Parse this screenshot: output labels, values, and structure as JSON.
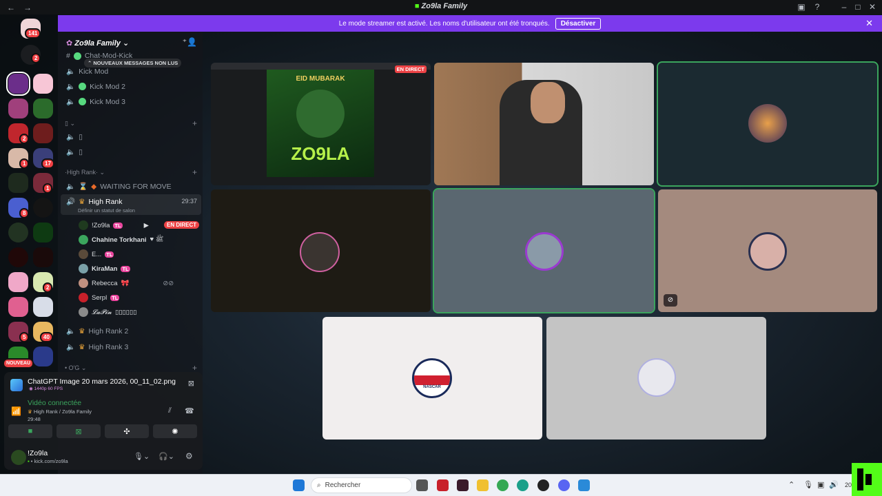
{
  "window": {
    "title": "Zo9la Family",
    "back": "←",
    "forward": "→"
  },
  "banner": {
    "text": "Le mode streamer est activé. Les noms d'utilisateur ont été tronqués.",
    "button": "Désactiver"
  },
  "rail": {
    "home_badge": "141",
    "dm_badge": "2",
    "new_label": "NOUVEAU",
    "badges": [
      "2",
      "1",
      "17",
      "1",
      "1",
      "8",
      "2",
      "5",
      "40"
    ]
  },
  "server": {
    "name": "Zo9la Family"
  },
  "channels": {
    "new_messages": "NOUVEAUX MESSAGES NON LUS",
    "text_top": "Chat-Mod-Kick",
    "kick_mods": [
      "Kick Mod",
      "Kick Mod 2",
      "Kick Mod 3"
    ],
    "high_rank_cat": "High Rank",
    "waiting": "WAITING FOR MOVE",
    "active": {
      "name": "High Rank",
      "timer": "29:37",
      "status": "Définir un statut de salon"
    },
    "users": [
      {
        "name": "!Zo9la",
        "tag": "TL",
        "live": "EN DIRECT"
      },
      {
        "name": "Chahine Torkhani",
        "extra": "♥ ﷺ"
      },
      {
        "name": "E...",
        "tag": "TL"
      },
      {
        "name": "KiraMan",
        "tag": "TL"
      },
      {
        "name": "Rebecca",
        "extra": "🎀"
      },
      {
        "name": "Serpl",
        "tag": "TL"
      },
      {
        "name": "𝓛𝓪𝓟𝓲𝓷",
        "extra": "▯▯▯▯▯▯"
      }
    ],
    "high_rank_2": "High Rank 2",
    "high_rank_3": "High Rank 3",
    "og_cat": "O'G"
  },
  "panel": {
    "stream_name": "ChatGPT Image 20 mars 2026, 00_11_02.png",
    "quality": "1440p 60 FPS",
    "voice_status": "Vidéo connectée",
    "voice_location": "High Rank / Zo9la Family",
    "voice_time": "29:48",
    "user_name": "!Zo9la",
    "user_status": "kick.com/zo9la"
  },
  "tiles": {
    "live_badge": "EN DIRECT",
    "eid_text": "EID MUBARAK",
    "brand": "ZO9LA",
    "helmet_text": "NASCAR"
  },
  "taskbar": {
    "search": "Rechercher",
    "time": "20:..."
  },
  "colors": {
    "accent": "#7c3aed",
    "speaking": "#3ba55d",
    "live": "#ed4245",
    "brand_green": "#53fc18"
  }
}
